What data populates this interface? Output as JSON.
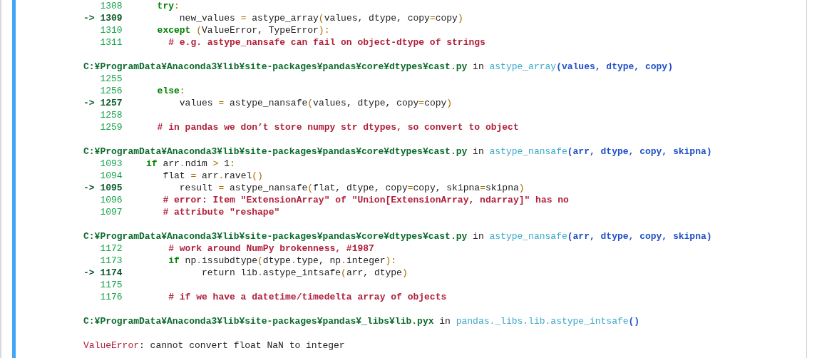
{
  "frames": [
    {
      "lines": [
        {
          "number": "1308",
          "current": false,
          "code": [
            {
              "kind": "kw",
              "text": "  try"
            },
            {
              "kind": "op",
              "text": ":"
            }
          ]
        },
        {
          "marker": "->",
          "number": "1309",
          "current": true,
          "code": [
            {
              "kind": "tx",
              "text": "      new_values "
            },
            {
              "kind": "op",
              "text": "="
            },
            {
              "kind": "tx",
              "text": " astype_array"
            },
            {
              "kind": "op",
              "text": "("
            },
            {
              "kind": "tx",
              "text": "values, dtype, copy"
            },
            {
              "kind": "op",
              "text": "="
            },
            {
              "kind": "tx",
              "text": "copy"
            },
            {
              "kind": "op",
              "text": ")"
            }
          ]
        },
        {
          "number": "1310",
          "current": false,
          "code": [
            {
              "kind": "kw",
              "text": "  except"
            },
            {
              "kind": "op",
              "text": " ("
            },
            {
              "kind": "tx",
              "text": "ValueError, TypeError"
            },
            {
              "kind": "op",
              "text": "):"
            }
          ]
        },
        {
          "number": "1311",
          "current": false,
          "code": [
            {
              "kind": "cm",
              "text": "    # e.g. astype_nansafe can fail on object-dtype of strings"
            }
          ]
        }
      ]
    },
    {
      "file": "C:¥ProgramData¥Anaconda3¥lib¥site-packages¥pandas¥core¥dtypes¥cast.py",
      "in": "in",
      "function": "astype_array",
      "args": "(values, dtype, copy)",
      "lines": [
        {
          "number": "1255",
          "current": false
        },
        {
          "number": "1256",
          "current": false,
          "code": [
            {
              "kind": "kw",
              "text": "  else"
            },
            {
              "kind": "op",
              "text": ":"
            }
          ]
        },
        {
          "marker": "->",
          "number": "1257",
          "current": true,
          "code": [
            {
              "kind": "tx",
              "text": "      values "
            },
            {
              "kind": "op",
              "text": "="
            },
            {
              "kind": "tx",
              "text": " astype_nansafe"
            },
            {
              "kind": "op",
              "text": "("
            },
            {
              "kind": "tx",
              "text": "values, dtype, copy"
            },
            {
              "kind": "op",
              "text": "="
            },
            {
              "kind": "tx",
              "text": "copy"
            },
            {
              "kind": "op",
              "text": ")"
            }
          ]
        },
        {
          "number": "1258",
          "current": false
        },
        {
          "number": "1259",
          "current": false,
          "code": [
            {
              "kind": "cm",
              "text": "  # in pandas we don’t store numpy str dtypes, so convert to object"
            }
          ]
        }
      ]
    },
    {
      "file": "C:¥ProgramData¥Anaconda3¥lib¥site-packages¥pandas¥core¥dtypes¥cast.py",
      "in": "in",
      "function": "astype_nansafe",
      "args": "(arr, dtype, copy, skipna)",
      "lines": [
        {
          "number": "1093",
          "current": false,
          "code": [
            {
              "kind": "kw",
              "text": "if"
            },
            {
              "kind": "tx",
              "text": " arr"
            },
            {
              "kind": "op",
              "text": "."
            },
            {
              "kind": "tx",
              "text": "ndim "
            },
            {
              "kind": "op",
              "text": ">"
            },
            {
              "kind": "tx",
              "text": " 1"
            },
            {
              "kind": "op",
              "text": ":"
            }
          ]
        },
        {
          "number": "1094",
          "current": false,
          "code": [
            {
              "kind": "tx",
              "text": "   flat "
            },
            {
              "kind": "op",
              "text": "="
            },
            {
              "kind": "tx",
              "text": " arr"
            },
            {
              "kind": "op",
              "text": "."
            },
            {
              "kind": "tx",
              "text": "ravel"
            },
            {
              "kind": "op",
              "text": "()"
            }
          ]
        },
        {
          "marker": "->",
          "number": "1095",
          "current": true,
          "code": [
            {
              "kind": "tx",
              "text": "      result "
            },
            {
              "kind": "op",
              "text": "="
            },
            {
              "kind": "tx",
              "text": " astype_nansafe"
            },
            {
              "kind": "op",
              "text": "("
            },
            {
              "kind": "tx",
              "text": "flat, dtype, copy"
            },
            {
              "kind": "op",
              "text": "="
            },
            {
              "kind": "tx",
              "text": "copy, skipna"
            },
            {
              "kind": "op",
              "text": "="
            },
            {
              "kind": "tx",
              "text": "skipna"
            },
            {
              "kind": "op",
              "text": ")"
            }
          ]
        },
        {
          "number": "1096",
          "current": false,
          "code": [
            {
              "kind": "cm",
              "text": "   # error: Item \"ExtensionArray\" of \"Union[ExtensionArray, ndarray]\" has no"
            }
          ]
        },
        {
          "number": "1097",
          "current": false,
          "code": [
            {
              "kind": "cm",
              "text": "   # attribute \"reshape\""
            }
          ]
        }
      ]
    },
    {
      "file": "C:¥ProgramData¥Anaconda3¥lib¥site-packages¥pandas¥core¥dtypes¥cast.py",
      "in": "in",
      "function": "astype_nansafe",
      "args": "(arr, dtype, copy, skipna)",
      "lines": [
        {
          "number": "1172",
          "current": false,
          "code": [
            {
              "kind": "cm",
              "text": "    # work around NumPy brokenness, #1987"
            }
          ]
        },
        {
          "number": "1173",
          "current": false,
          "code": [
            {
              "kind": "kw",
              "text": "    if"
            },
            {
              "kind": "tx",
              "text": " np"
            },
            {
              "kind": "op",
              "text": "."
            },
            {
              "kind": "tx",
              "text": "issubdtype"
            },
            {
              "kind": "op",
              "text": "("
            },
            {
              "kind": "tx",
              "text": "dtype"
            },
            {
              "kind": "op",
              "text": "."
            },
            {
              "kind": "tx",
              "text": "type, np"
            },
            {
              "kind": "op",
              "text": "."
            },
            {
              "kind": "tx",
              "text": "integer"
            },
            {
              "kind": "op",
              "text": "):"
            }
          ]
        },
        {
          "marker": "->",
          "number": "1174",
          "current": true,
          "code": [
            {
              "kind": "tx",
              "text": "          return lib"
            },
            {
              "kind": "op",
              "text": "."
            },
            {
              "kind": "tx",
              "text": "astype_intsafe"
            },
            {
              "kind": "op",
              "text": "("
            },
            {
              "kind": "tx",
              "text": "arr, dtype"
            },
            {
              "kind": "op",
              "text": ")"
            }
          ]
        },
        {
          "number": "1175",
          "current": false
        },
        {
          "number": "1176",
          "current": false,
          "code": [
            {
              "kind": "cm",
              "text": "    # if we have a datetime/timedelta array of objects"
            }
          ]
        }
      ]
    },
    {
      "file": "C:¥ProgramData¥Anaconda3¥lib¥site-packages¥pandas¥_libs¥lib.pyx",
      "in": "in",
      "function": "pandas._libs.lib.astype_intsafe",
      "args": "()"
    }
  ],
  "error": {
    "type": "ValueError",
    "message": ": cannot convert float NaN to integer"
  }
}
